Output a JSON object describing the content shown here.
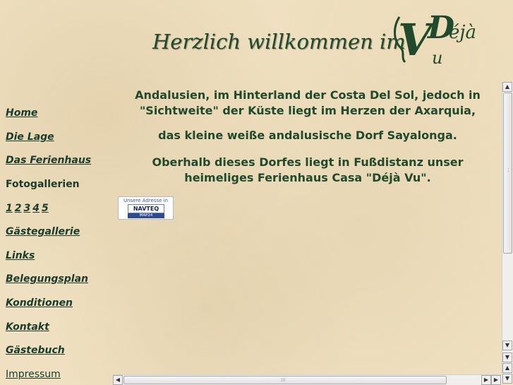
{
  "header": {
    "title": "Herzlich willkommen im",
    "logo": {
      "letters_main": "V",
      "letter_d": "D",
      "suffix": "éjà",
      "letter_u": "u"
    }
  },
  "sidebar": {
    "items": [
      {
        "label": "Home"
      },
      {
        "label": "Die Lage"
      },
      {
        "label": "Das Ferienhaus"
      },
      {
        "label": "Fotogallerien"
      },
      {
        "numbers": [
          "1",
          "2",
          "3",
          "4",
          "5"
        ]
      },
      {
        "label": "Gästegallerie"
      },
      {
        "label": "Links"
      },
      {
        "label": "Belegungsplan"
      },
      {
        "label": "Konditionen"
      },
      {
        "label": "Kontakt"
      },
      {
        "label": "Gästebuch"
      },
      {
        "label": "Impressum"
      }
    ]
  },
  "content": {
    "para1_line1": "Andalusien, im Hinterland der Costa Del Sol, jedoch in",
    "para1_line2": "\"Sichtweite\" der Küste liegt im Herzen der Axarquia,",
    "para2": "das kleine weiße andalusische Dorf Sayalonga.",
    "para3_line1": "Oberhalb dieses Dorfes liegt in Fußdistanz unser",
    "para3_line2": "heimeliges Ferienhaus Casa \"Déjà Vu\"."
  },
  "map_badge": {
    "caption": "Unsere Adresse in",
    "brand": "NAVTEQ",
    "sub": "MAP24"
  },
  "colors": {
    "text_green": "#1f4a2b",
    "background": "#eee0c0"
  }
}
